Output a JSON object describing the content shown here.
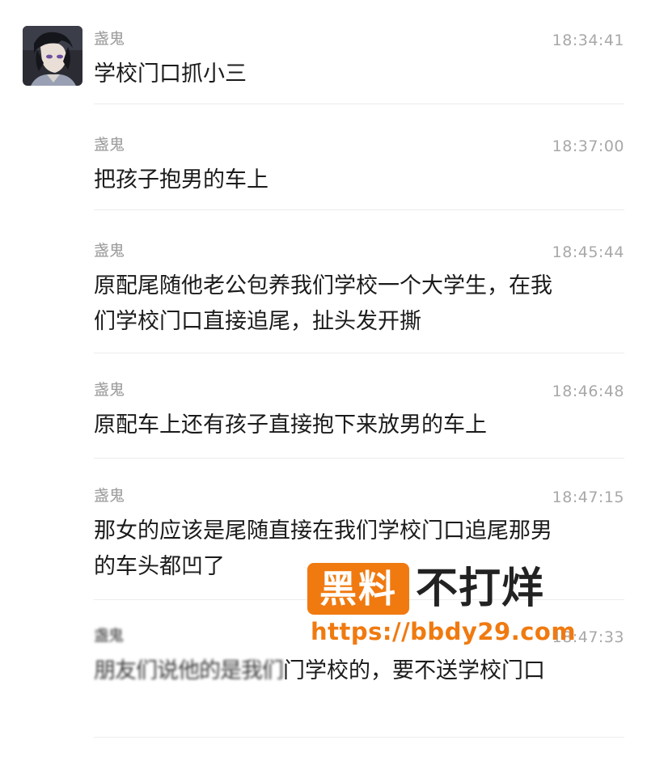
{
  "chat": {
    "messages": [
      {
        "sender": "盏鬼",
        "time": "18:34:41",
        "text": "学校门口抓小三"
      },
      {
        "sender": "盏鬼",
        "time": "18:37:00",
        "text": "把孩子抱男的车上"
      },
      {
        "sender": "盏鬼",
        "time": "18:45:44",
        "lines": [
          "原配尾随他老公包养我们学校一个大学生，在我",
          "们学校门口直接追尾，扯头发开撕"
        ]
      },
      {
        "sender": "盏鬼",
        "time": "18:46:48",
        "text": "原配车上还有孩子直接抱下来放男的车上"
      },
      {
        "sender": "盏鬼",
        "time": "18:47:15",
        "lines": [
          "那女的应该是尾随直接在我们学校门口追尾那男",
          "的车头都凹了"
        ]
      },
      {
        "sender": "盏鬼",
        "time": "18:47:33",
        "obscured_text": "朋友们说他的是我们",
        "text": "门学校的，要不送学校门口"
      }
    ]
  },
  "watermark": {
    "badge": "黑料",
    "title": "不打烊",
    "url": "https://bbdy29.com"
  },
  "colors": {
    "watermark_orange": "#f07a10",
    "text": "#1b1b1b",
    "meta": "#9a9a9a"
  }
}
